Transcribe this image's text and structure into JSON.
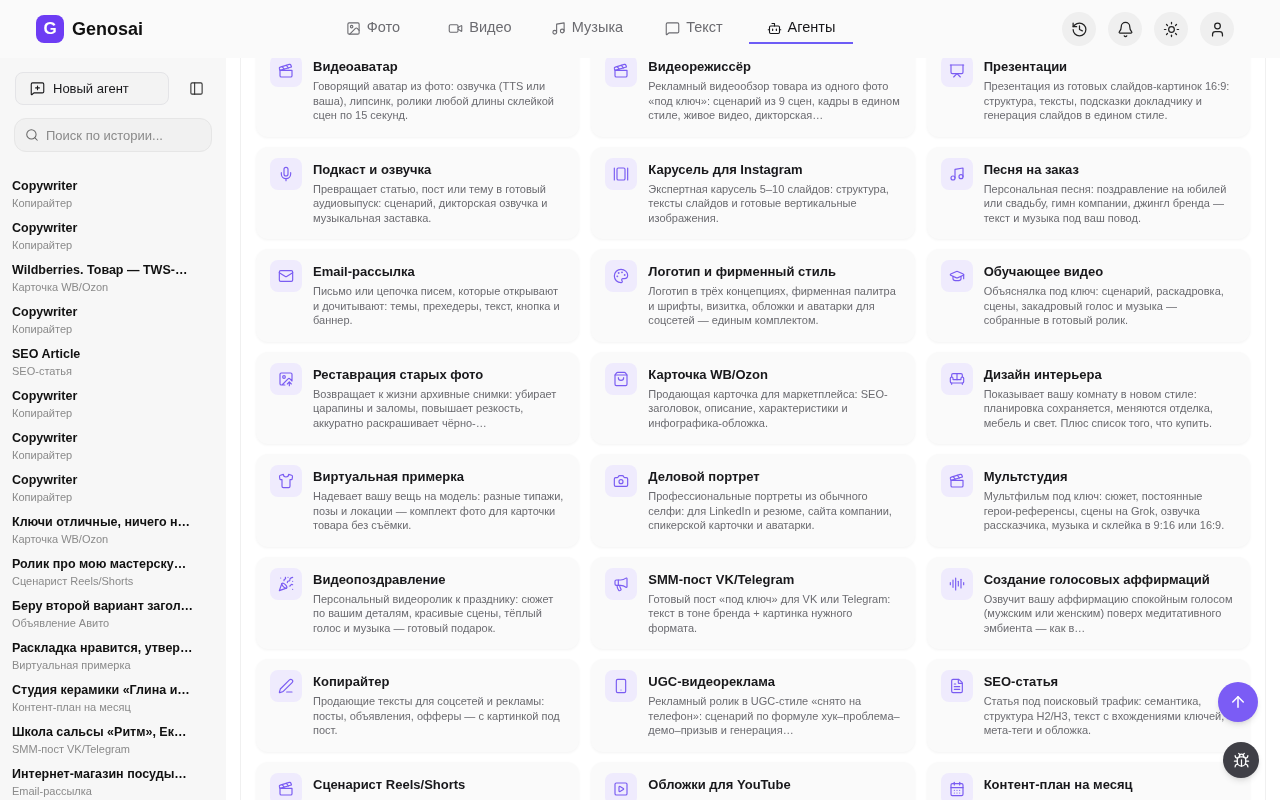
{
  "brand": {
    "mark": "G",
    "name": "Genosai"
  },
  "tabs": [
    {
      "label": "Фото",
      "selected": false
    },
    {
      "label": "Видео",
      "selected": false
    },
    {
      "label": "Музыка",
      "selected": false
    },
    {
      "label": "Текст",
      "selected": false
    },
    {
      "label": "Агенты",
      "selected": true
    }
  ],
  "sidebar": {
    "new_agent_button": "Новый агент",
    "search": {
      "placeholder": "Поиск по истории..."
    },
    "history": [
      {
        "title": "Copywriter",
        "subtitle": "Копирайтер"
      },
      {
        "title": "Copywriter",
        "subtitle": "Копирайтер"
      },
      {
        "title": "Wildberries. Товар — TWS-…",
        "subtitle": "Карточка WB/Ozon"
      },
      {
        "title": "Copywriter",
        "subtitle": "Копирайтер"
      },
      {
        "title": "SEO Article",
        "subtitle": "SEO-статья"
      },
      {
        "title": "Copywriter",
        "subtitle": "Копирайтер"
      },
      {
        "title": "Copywriter",
        "subtitle": "Копирайтер"
      },
      {
        "title": "Copywriter",
        "subtitle": "Копирайтер"
      },
      {
        "title": "Ключи отличные, ничего н…",
        "subtitle": "Карточка WB/Ozon"
      },
      {
        "title": "Ролик про мою мастерску…",
        "subtitle": "Сценарист Reels/Shorts"
      },
      {
        "title": "Беру второй вариант загол…",
        "subtitle": "Объявление Авито"
      },
      {
        "title": "Раскладка нравится, утвер…",
        "subtitle": "Виртуальная примерка"
      },
      {
        "title": "Студия керамики «Глина и…",
        "subtitle": "Контент-план на месяц"
      },
      {
        "title": "Школа сальсы «Ритм», Ек…",
        "subtitle": "SMM-пост VK/Telegram"
      },
      {
        "title": "Интернет-магазин посуды…",
        "subtitle": "Email-рассылка"
      }
    ]
  },
  "agents": [
    {
      "title": "Видеоаватар",
      "description": "Говорящий аватар из фото: озвучка (TTS или ваша), липсинк, ролики любой длины склейкой сцен по 15 секунд."
    },
    {
      "title": "Видеорежиссёр",
      "description": "Рекламный видеообзор товара из одного фото «под ключ»: сценарий из 9 сцен, кадры в едином стиле, живое видео, дикторская…"
    },
    {
      "title": "Презентации",
      "description": "Презентация из готовых слайдов-картинок 16:9: структура, тексты, подсказки докладчику и генерация слайдов в едином стиле."
    },
    {
      "title": "Подкаст и озвучка",
      "description": "Превращает статью, пост или тему в готовый аудиовыпуск: сценарий, дикторская озвучка и музыкальная заставка."
    },
    {
      "title": "Карусель для Instagram",
      "description": "Экспертная карусель 5–10 слайдов: структура, тексты слайдов и готовые вертикальные изображения."
    },
    {
      "title": "Песня на заказ",
      "description": "Персональная песня: поздравление на юбилей или свадьбу, гимн компании, джингл бренда — текст и музыка под ваш повод."
    },
    {
      "title": "Email-рассылка",
      "description": "Письмо или цепочка писем, которые открывают и дочитывают: темы, прехедеры, текст, кнопка и баннер."
    },
    {
      "title": "Логотип и фирменный стиль",
      "description": "Логотип в трёх концепциях, фирменная палитра и шрифты, визитка, обложки и аватарки для соцсетей — единым комплектом."
    },
    {
      "title": "Обучающее видео",
      "description": "Объяснялка под ключ: сценарий, раскадровка, сцены, закадровый голос и музыка — собранные в готовый ролик."
    },
    {
      "title": "Реставрация старых фото",
      "description": "Возвращает к жизни архивные снимки: убирает царапины и заломы, повышает резкость, аккуратно раскрашивает чёрно-…"
    },
    {
      "title": "Карточка WB/Ozon",
      "description": "Продающая карточка для маркетплейса: SEO-заголовок, описание, характеристики и инфографика-обложка."
    },
    {
      "title": "Дизайн интерьера",
      "description": "Показывает вашу комнату в новом стиле: планировка сохраняется, меняются отделка, мебель и свет. Плюс список того, что купить."
    },
    {
      "title": "Виртуальная примерка",
      "description": "Надевает вашу вещь на модель: разные типажи, позы и локации — комплект фото для карточки товара без съёмки."
    },
    {
      "title": "Деловой портрет",
      "description": "Профессиональные портреты из обычного селфи: для LinkedIn и резюме, сайта компании, спикерской карточки и аватарки."
    },
    {
      "title": "Мультстудия",
      "description": "Мультфильм под ключ: сюжет, постоянные герои-референсы, сцены на Grok, озвучка рассказчика, музыка и склейка в 9:16 или 16:9."
    },
    {
      "title": "Видеопоздравление",
      "description": "Персональный видеоролик к празднику: сюжет по вашим деталям, красивые сцены, тёплый голос и музыка — готовый подарок."
    },
    {
      "title": "SMM-пост VK/Telegram",
      "description": "Готовый пост «под ключ» для VK или Telegram: текст в тоне бренда + картинка нужного формата."
    },
    {
      "title": "Создание голосовых аффирмаций",
      "description": "Озвучит вашу аффирмацию спокойным голосом (мужским или женским) поверх медитативного эмбиента — как в…"
    },
    {
      "title": "Копирайтер",
      "description": "Продающие тексты для соцсетей и рекламы: посты, объявления, офферы — с картинкой под пост."
    },
    {
      "title": "UGC-видеореклама",
      "description": "Рекламный ролик в UGC-стиле «снято на телефон»: сценарий по формуле хук–проблема–демо–призыв и генерация…"
    },
    {
      "title": "SEO-статья",
      "description": "Статья под поисковый трафик: семантика, структура H2/H3, текст с вхождениями ключей, мета-теги и обложка."
    },
    {
      "title": "Сценарист Reels/Shorts"
    },
    {
      "title": "Обложки для YouTube"
    },
    {
      "title": "Контент-план на месяц"
    }
  ]
}
